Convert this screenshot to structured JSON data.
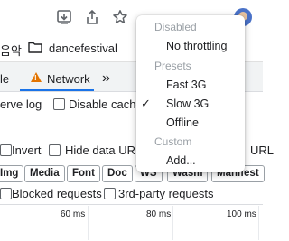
{
  "bookmarks": {
    "partial_item_label": "음악",
    "folder_label": "dancefestival"
  },
  "devtools": {
    "tab_partial": "le",
    "tab_network": "Network",
    "more_tabs": "»",
    "preserve_log_partial": "erve log",
    "disable_cache_label": "Disable cache",
    "invert_label": "Invert",
    "hide_data_url_label": "Hide data URL",
    "url_partial": "URL",
    "filter_chips": [
      "Img",
      "Media",
      "Font",
      "Doc",
      "WS",
      "Wasm",
      "Manifest"
    ],
    "blocked_requests_label": "Blocked requests",
    "third_party_label": "3rd-party requests",
    "timeline_ticks": [
      "60 ms",
      "80 ms",
      "100 ms"
    ]
  },
  "throttle_menu": {
    "header_disabled": "Disabled",
    "item_no_throttling": "No throttling",
    "header_presets": "Presets",
    "item_fast3g": "Fast 3G",
    "item_slow3g": "Slow 3G",
    "item_offline": "Offline",
    "header_custom": "Custom",
    "item_add": "Add...",
    "selected_check": "✓"
  }
}
